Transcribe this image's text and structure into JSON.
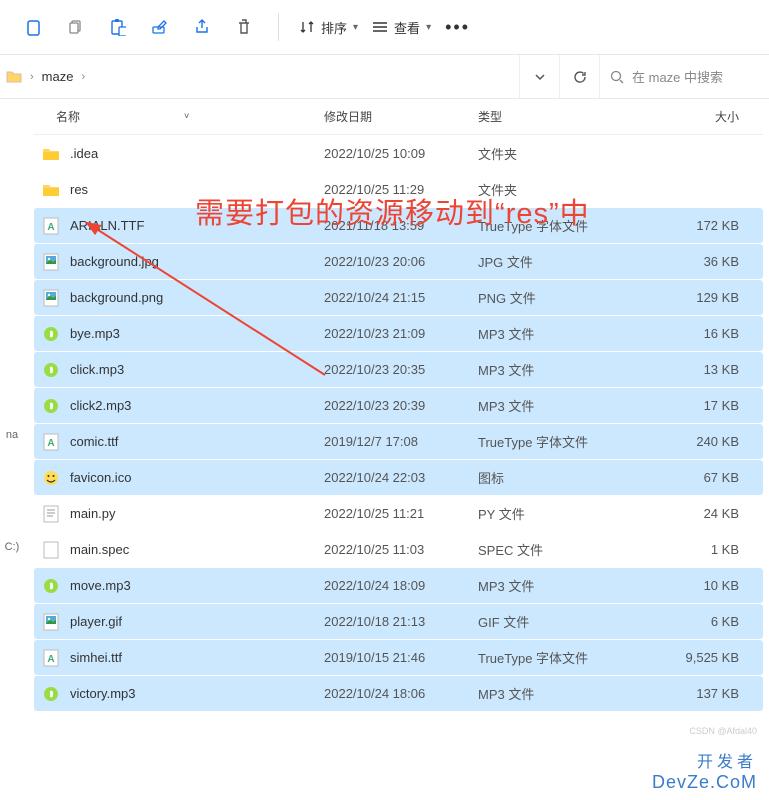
{
  "toolbar": {
    "sort_label": "排序",
    "view_label": "查看"
  },
  "breadcrumb": {
    "current": "maze"
  },
  "search": {
    "placeholder": "在 maze 中搜索"
  },
  "columns": {
    "name": "名称",
    "date": "修改日期",
    "type": "类型",
    "size": "大小"
  },
  "sidebar": {
    "label_na": "na",
    "label_c": "C:)"
  },
  "files": [
    {
      "icon": "folder",
      "name": ".idea",
      "date": "2022/10/25 10:09",
      "type": "文件夹",
      "size": "",
      "sel": false
    },
    {
      "icon": "folder",
      "name": "res",
      "date": "2022/10/25 11:29",
      "type": "文件夹",
      "size": "",
      "sel": false
    },
    {
      "icon": "font",
      "name": "ARIALN.TTF",
      "date": "2021/11/18 13:59",
      "type": "TrueType 字体文件",
      "size": "172 KB",
      "sel": true
    },
    {
      "icon": "img",
      "name": "background.jpg",
      "date": "2022/10/23 20:06",
      "type": "JPG 文件",
      "size": "36 KB",
      "sel": true
    },
    {
      "icon": "img",
      "name": "background.png",
      "date": "2022/10/24 21:15",
      "type": "PNG 文件",
      "size": "129 KB",
      "sel": true
    },
    {
      "icon": "audio",
      "name": "bye.mp3",
      "date": "2022/10/23 21:09",
      "type": "MP3 文件",
      "size": "16 KB",
      "sel": true
    },
    {
      "icon": "audio",
      "name": "click.mp3",
      "date": "2022/10/23 20:35",
      "type": "MP3 文件",
      "size": "13 KB",
      "sel": true
    },
    {
      "icon": "audio",
      "name": "click2.mp3",
      "date": "2022/10/23 20:39",
      "type": "MP3 文件",
      "size": "17 KB",
      "sel": true
    },
    {
      "icon": "font",
      "name": "comic.ttf",
      "date": "2019/12/7 17:08",
      "type": "TrueType 字体文件",
      "size": "240 KB",
      "sel": true
    },
    {
      "icon": "ico",
      "name": "favicon.ico",
      "date": "2022/10/24 22:03",
      "type": "图标",
      "size": "67 KB",
      "sel": true
    },
    {
      "icon": "py",
      "name": "main.py",
      "date": "2022/10/25 11:21",
      "type": "PY 文件",
      "size": "24 KB",
      "sel": false
    },
    {
      "icon": "file",
      "name": "main.spec",
      "date": "2022/10/25 11:03",
      "type": "SPEC 文件",
      "size": "1 KB",
      "sel": false
    },
    {
      "icon": "audio",
      "name": "move.mp3",
      "date": "2022/10/24 18:09",
      "type": "MP3 文件",
      "size": "10 KB",
      "sel": true
    },
    {
      "icon": "img",
      "name": "player.gif",
      "date": "2022/10/18 21:13",
      "type": "GIF 文件",
      "size": "6 KB",
      "sel": true
    },
    {
      "icon": "font",
      "name": "simhei.ttf",
      "date": "2019/10/15 21:46",
      "type": "TrueType 字体文件",
      "size": "9,525 KB",
      "sel": true
    },
    {
      "icon": "audio",
      "name": "victory.mp3",
      "date": "2022/10/24 18:06",
      "type": "MP3 文件",
      "size": "137 KB",
      "sel": true
    }
  ],
  "annotation": {
    "text": "需要打包的资源移动到“res”中"
  },
  "watermark": {
    "line1": "开发者",
    "line2": "DevZe.CoM",
    "small": "CSDN @Afdal40"
  }
}
